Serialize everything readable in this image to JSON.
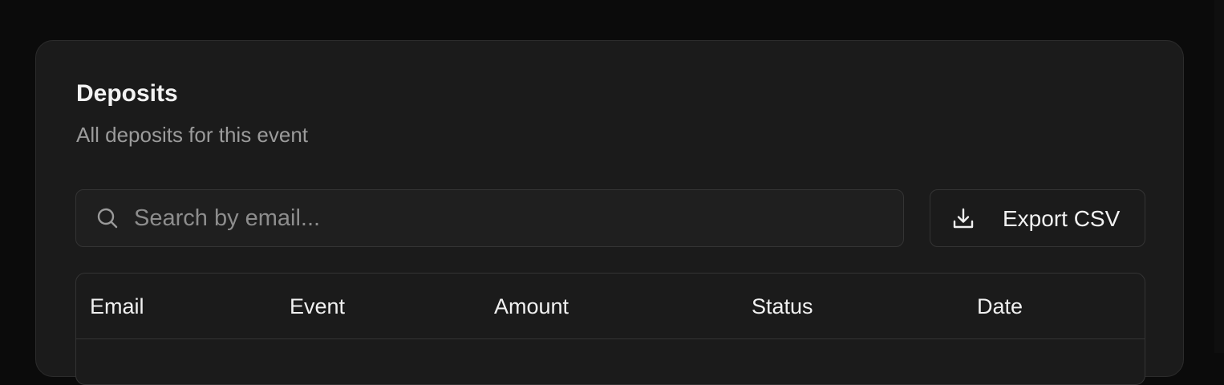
{
  "card": {
    "title": "Deposits",
    "subtitle": "All deposits for this event"
  },
  "search": {
    "placeholder": "Search by email...",
    "icon": "search-icon"
  },
  "export": {
    "label": "Export CSV",
    "icon": "download-icon"
  },
  "table": {
    "columns": [
      "Email",
      "Event",
      "Amount",
      "Status",
      "Date"
    ]
  },
  "colors": {
    "page_background": "#0b0b0b",
    "card_background": "#1b1b1b",
    "border": "#343434",
    "text_primary": "#f1f1f1",
    "text_muted": "#9b9b9b"
  }
}
